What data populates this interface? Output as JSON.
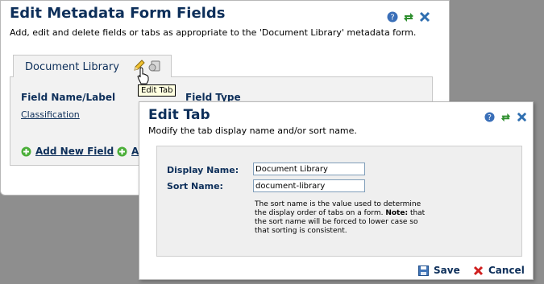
{
  "outer": {
    "title": "Edit Metadata Form Fields",
    "subtitle": "Add, edit and delete fields or tabs as appropriate to the 'Document Library' metadata form.",
    "tab_label": "Document Library",
    "tooltip": "Edit Tab",
    "col_name": "Field Name/Label",
    "col_type": "Field Type",
    "field_link": "Classification",
    "add_field": "Add New Field",
    "add_other": "Ad"
  },
  "edit": {
    "title": "Edit Tab",
    "subtitle": "Modify the tab display name and/or sort name.",
    "display_label": "Display Name:",
    "display_value": "Document Library",
    "sort_label": "Sort Name:",
    "sort_value": "document-library",
    "help_pre": "The sort name is the value used to determine the display order of tabs on a form.",
    "help_note": "Note:",
    "help_post": "that the sort name will be forced to lower case so that sorting is consistent.",
    "save": "Save",
    "cancel": "Cancel"
  },
  "icons": {
    "help": "help-icon",
    "refresh": "refresh-icon",
    "close": "close-icon",
    "edit": "pencil-icon",
    "delete": "delete-tab-icon",
    "add": "add-icon",
    "save": "save-icon",
    "cancel": "cancel-icon"
  },
  "colors": {
    "heading": "#0d2f5a",
    "overlay": "#8e8e8e",
    "help_blue": "#3a6fb8",
    "refresh_green": "#2f8f2f",
    "close_blue": "#2f6fb0",
    "cancel_red": "#d02020"
  }
}
